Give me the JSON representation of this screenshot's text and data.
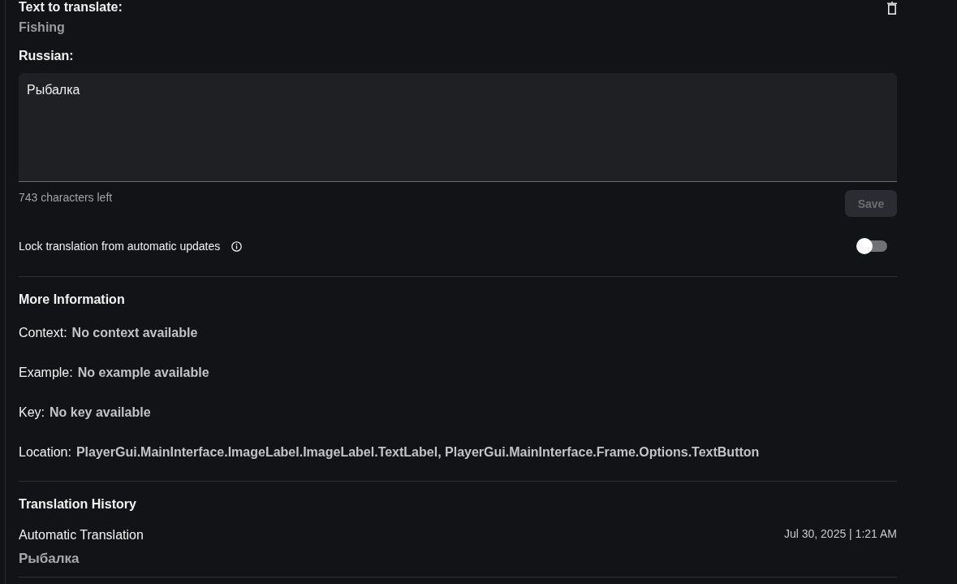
{
  "source": {
    "label": "Text to translate:",
    "text": "Fishing"
  },
  "translation": {
    "label": "Russian:",
    "value": "Рыбалка",
    "chars_left": "743 characters left",
    "save_button": {
      "label": "Save",
      "disabled": true
    }
  },
  "lock": {
    "label": "Lock translation from automatic updates",
    "on": false
  },
  "more_info": {
    "title": "More Information",
    "fields": [
      {
        "label": "Context:",
        "value": "No context available"
      },
      {
        "label": "Example:",
        "value": "No example available"
      },
      {
        "label": "Key:",
        "value": "No key available"
      },
      {
        "label": "Location:",
        "value": "PlayerGui.MainInterface.ImageLabel.ImageLabel.TextLabel, PlayerGui.MainInterface.Frame.Options.TextButton"
      }
    ]
  },
  "history": {
    "title": "Translation History",
    "entries": [
      {
        "source": "Automatic Translation",
        "date": "Jul 30, 2025 | 1:21 AM",
        "text": "Рыбалка"
      }
    ]
  }
}
